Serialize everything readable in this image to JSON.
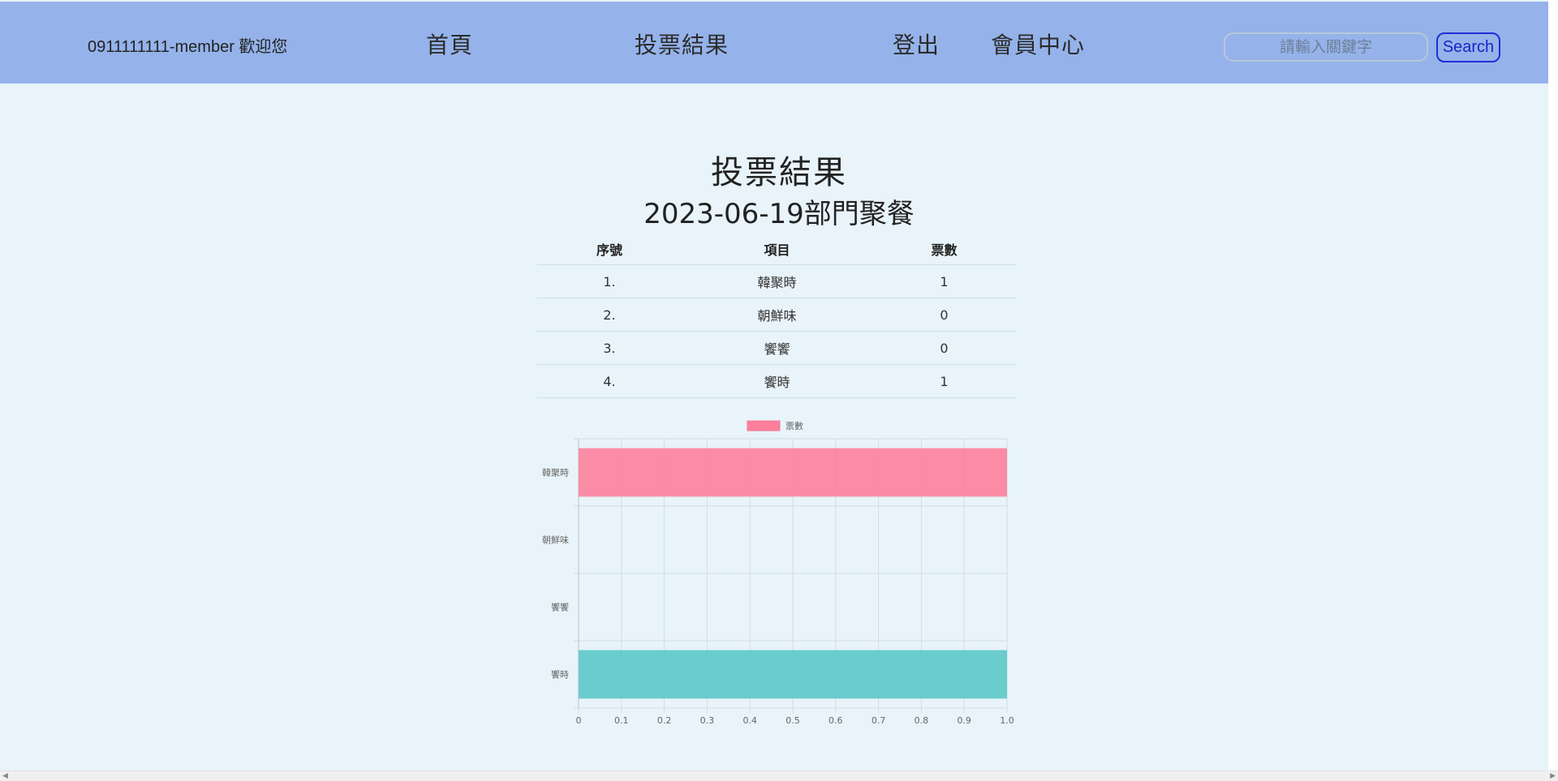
{
  "navbar": {
    "welcome_text": "0911111111-member 歡迎您",
    "links": {
      "home": "首頁",
      "results": "投票結果",
      "logout": "登出",
      "member_center": "會員中心"
    },
    "search": {
      "placeholder": "請輸入關鍵字",
      "button_label": "Search"
    }
  },
  "main": {
    "title": "投票結果",
    "subtitle": "2023-06-19部門聚餐",
    "table": {
      "headers": [
        "序號",
        "項目",
        "票數"
      ],
      "rows": [
        {
          "index": "1.",
          "item": "韓聚時",
          "votes": "1"
        },
        {
          "index": "2.",
          "item": "朝鮮味",
          "votes": "0"
        },
        {
          "index": "3.",
          "item": "饗饗",
          "votes": "0"
        },
        {
          "index": "4.",
          "item": "饗時",
          "votes": "1"
        }
      ]
    }
  },
  "chart_data": {
    "type": "bar",
    "orientation": "horizontal",
    "categories": [
      "韓聚時",
      "朝鮮味",
      "饗饗",
      "饗時"
    ],
    "series": [
      {
        "name": "票數",
        "values": [
          1,
          0,
          0,
          1
        ]
      }
    ],
    "bar_colors": [
      "#fe7f9c",
      "#fda45b",
      "#fdd05a",
      "#5cc8c8"
    ],
    "xlim": [
      0,
      1.0
    ],
    "x_ticks": [
      "0",
      "0.1",
      "0.2",
      "0.3",
      "0.4",
      "0.5",
      "0.6",
      "0.7",
      "0.8",
      "0.9",
      "1.0"
    ],
    "grid": true,
    "legend_position": "top-center"
  },
  "colors": {
    "navbar_bg": "#95b3ea",
    "page_bg": "#e8f4f9",
    "search_button_accent": "#1e2fd6"
  }
}
